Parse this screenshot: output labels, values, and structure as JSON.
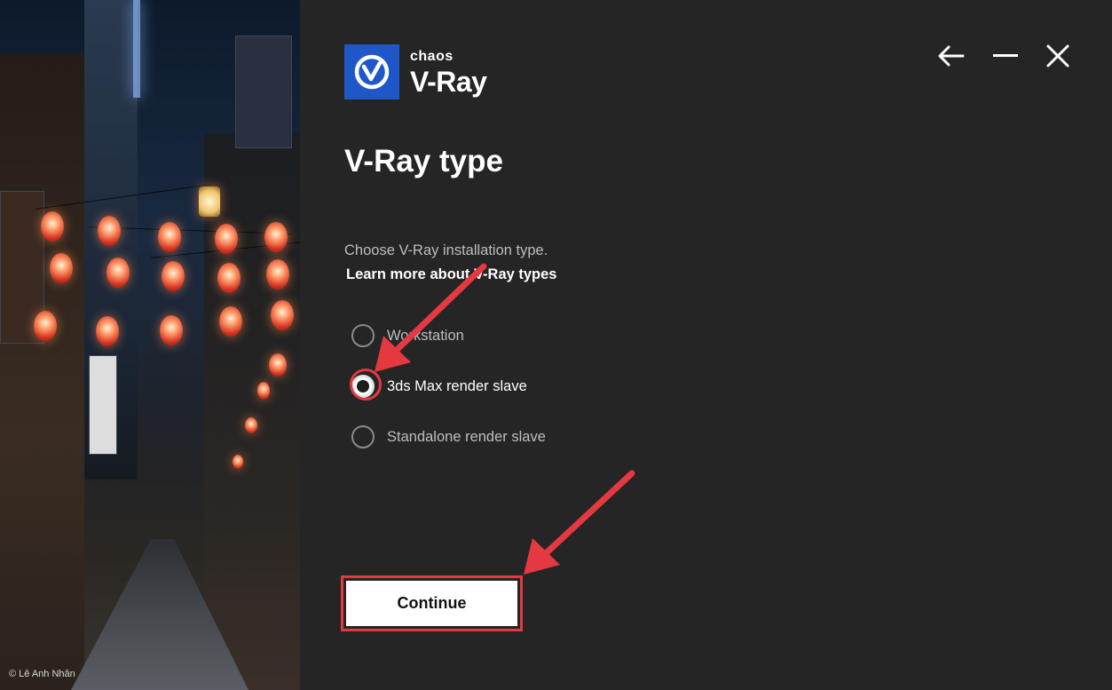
{
  "art": {
    "credit": "© Lê Anh Nhân"
  },
  "logo": {
    "brand": "chaos",
    "product": "V-Ray"
  },
  "window_controls": {
    "back_icon": "arrow-left-icon",
    "minimize_icon": "minimize-icon",
    "close_icon": "close-icon"
  },
  "page": {
    "title": "V-Ray type",
    "subtitle": "Choose V-Ray installation type.",
    "learn_more": "Learn more about V-Ray types"
  },
  "options": [
    {
      "label": "Workstation",
      "selected": false
    },
    {
      "label": "3ds Max render slave",
      "selected": true
    },
    {
      "label": "Standalone render slave",
      "selected": false
    }
  ],
  "actions": {
    "continue_label": "Continue"
  },
  "colors": {
    "background": "#252525",
    "logo_blue": "#1f57c9",
    "annotation_red": "#e53941"
  }
}
